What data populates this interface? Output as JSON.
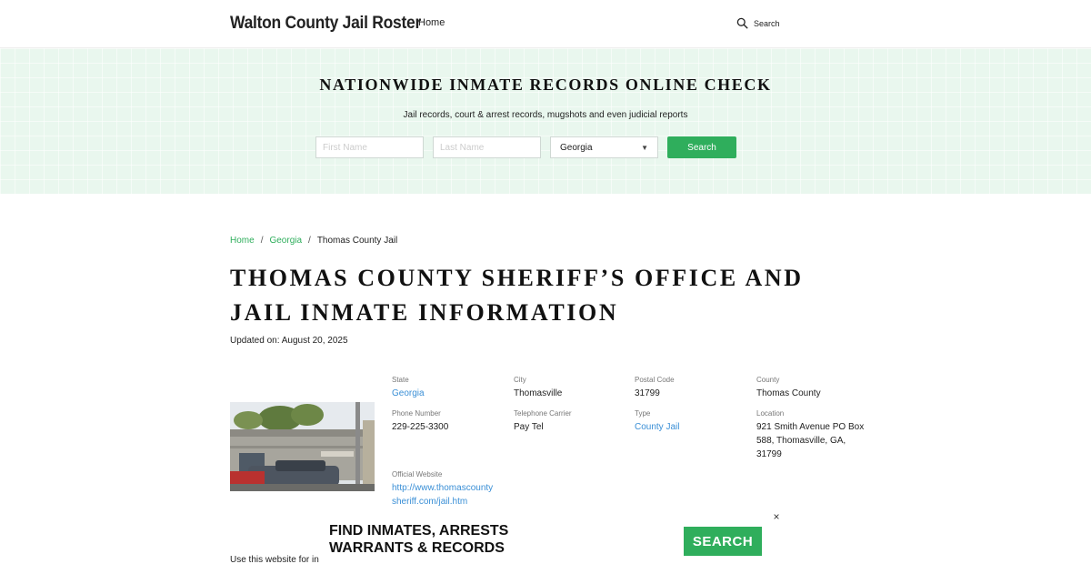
{
  "header": {
    "brand": "Walton County Jail Roster",
    "nav_home": "Home",
    "search_label": "Search"
  },
  "hero": {
    "title": "NATIONWIDE INMATE RECORDS ONLINE CHECK",
    "subtitle": "Jail records, court & arrest records, mugshots and even judicial reports",
    "first_name_placeholder": "First Name",
    "last_name_placeholder": "Last Name",
    "state_selected": "Georgia",
    "search_button": "Search"
  },
  "breadcrumb": {
    "home": "Home",
    "state": "Georgia",
    "current": "Thomas County Jail",
    "separator": "/"
  },
  "page": {
    "title": "THOMAS COUNTY SHERIFF’S OFFICE AND JAIL INMATE INFORMATION",
    "updated": "Updated on: August 20, 2025"
  },
  "info": {
    "state_label": "State",
    "state_value": "Georgia",
    "city_label": "City",
    "city_value": "Thomasville",
    "postal_label": "Postal Code",
    "postal_value": "31799",
    "county_label": "County",
    "county_value": "Thomas County",
    "phone_label": "Phone Number",
    "phone_value": "229-225-3300",
    "carrier_label": "Telephone Carrier",
    "carrier_value": "Pay Tel",
    "type_label": "Type",
    "type_value": "County Jail",
    "location_label": "Location",
    "location_value": "921 Smith Avenue PO Box 588, Thomasville, GA, 31799",
    "website_label": "Official Website",
    "website_value": "http://www.thomascountysheriff.com/jail.htm"
  },
  "ad": {
    "left_text": "Use this website for in",
    "title_line1": "FIND INMATES, ARRESTS",
    "title_line2": "WARRANTS & RECORDS",
    "button": "SEARCH",
    "close": "×"
  },
  "colors": {
    "accent_green": "#2fae5c",
    "link_blue": "#3a8fd6",
    "hero_bg": "#e9f7ee"
  }
}
